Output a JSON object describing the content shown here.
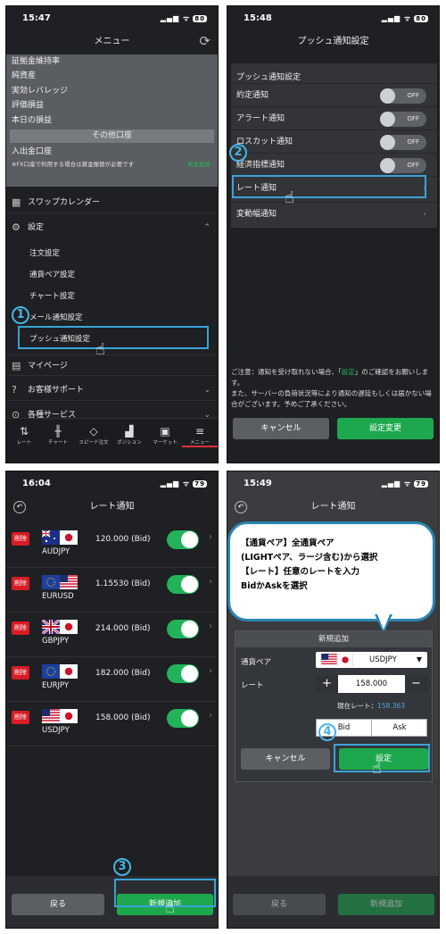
{
  "panel1": {
    "time": "15:47",
    "battery": "80",
    "title": "メニュー",
    "account_rows": [
      "証拠金維持率",
      "純資産",
      "実効レバレッジ",
      "評価損益",
      "本日の損益"
    ],
    "other_account": "その他口座",
    "deposit": "入出金口座",
    "deposit_note": "※FX口座で利用する場合は資金振替が必要です",
    "deposit_note_right": "資金振替",
    "swap_calendar": "スワップカレンダー",
    "settings": "設定",
    "sub_items": [
      "注文設定",
      "通貨ペア設定",
      "チャート設定",
      "メール通知設定",
      "プッシュ通知設定"
    ],
    "mypage": "マイページ",
    "support": "お客様サポート",
    "services": "各種サービス",
    "tabs": [
      "レート",
      "チャート",
      "スピード注文",
      "ポジション",
      "マーケット",
      "メニュー"
    ],
    "step": "1"
  },
  "panel2": {
    "time": "15:48",
    "battery": "80",
    "title": "プッシュ通知設定",
    "box_title": "プッシュ通知設定",
    "toggles": [
      {
        "label": "約定通知",
        "state": "OFF"
      },
      {
        "label": "アラート通知",
        "state": "OFF"
      },
      {
        "label": "ロスカット通知",
        "state": "OFF"
      },
      {
        "label": "経済指標通知",
        "state": "OFF"
      }
    ],
    "rate_notify": "レート通知",
    "change_notify": "変動幅通知",
    "caution_a": "ご注意：通知を受け取れない場合、「",
    "caution_g": "設定",
    "caution_b": "」のご確認をお願いします。",
    "caution_c": "また、サーバーの負荷状況等により通知の遅延もしくは届かない場合がございます。予めご了承ください。",
    "cancel": "キャンセル",
    "change": "設定変更",
    "step": "2"
  },
  "panel3": {
    "time": "16:04",
    "battery": "79",
    "title": "レート通知",
    "delete_label": "削除",
    "rows": [
      {
        "pair": "AUDJPY",
        "rate": "120.000 (Bid)"
      },
      {
        "pair": "EURUSD",
        "rate": "1.15530 (Bid)"
      },
      {
        "pair": "GBPJPY",
        "rate": "214.000 (Bid)"
      },
      {
        "pair": "EURJPY",
        "rate": "182.000 (Bid)"
      },
      {
        "pair": "USDJPY",
        "rate": "158.000 (Bid)"
      }
    ],
    "back": "戻る",
    "add": "新規追加",
    "step": "3"
  },
  "panel4": {
    "time": "15:49",
    "battery": "79",
    "title": "レート通知",
    "bubble_lines": [
      "【通貨ペア】全通貨ペア",
      "(LIGHTペア、ラージ含む)から選択",
      "【レート】任意のレートを入力",
      "BidかAskを選択"
    ],
    "modal_title": "新規追加",
    "pair_label": "通貨ペア",
    "pair_value": "USDJPY",
    "rate_label": "レート",
    "rate_value": "158.000",
    "current_rate_label": "現在レート：",
    "current_rate": "158.363",
    "bid": "Bid",
    "ask": "Ask",
    "cancel": "キャンセル",
    "set": "設定",
    "back": "戻る",
    "add": "新規追加",
    "step": "4"
  }
}
